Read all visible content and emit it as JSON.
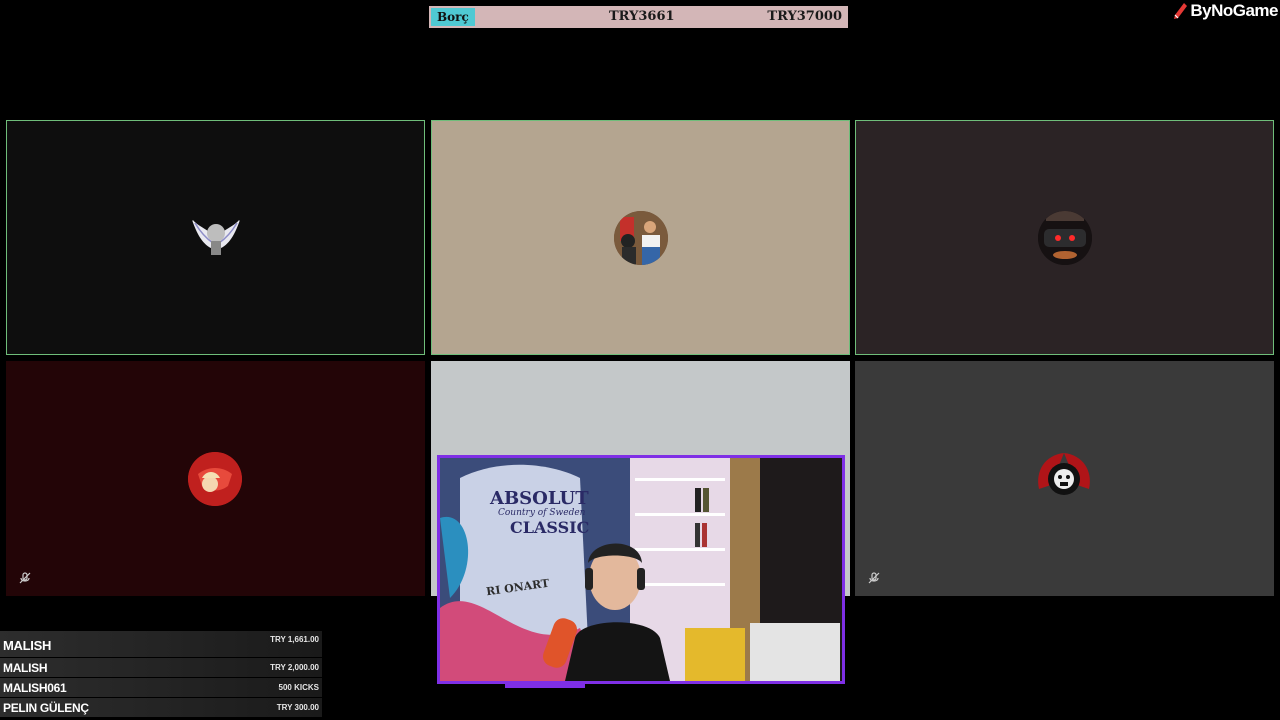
{
  "debt_bar": {
    "label": "Borç",
    "current": "TRY3661",
    "goal": "TRY37000"
  },
  "brand": {
    "name": "ByNoGame",
    "icon": "pencil-icon",
    "accent": "#e53935"
  },
  "tiles": [
    {
      "id": "tile-1",
      "avatar_icon": "winged-avatar",
      "background": "#0e0e0e",
      "active": true,
      "muted": false
    },
    {
      "id": "tile-2",
      "avatar_icon": "photo-avatar",
      "background": "#b4a590",
      "active": true,
      "muted": false
    },
    {
      "id": "tile-3",
      "avatar_icon": "car-avatar",
      "background": "#2b2325",
      "active": true,
      "muted": false
    },
    {
      "id": "tile-4",
      "avatar_icon": "red-figure-avatar",
      "background": "#230507",
      "active": false,
      "muted": true
    },
    {
      "id": "tile-5",
      "avatar_icon": "none",
      "background": "#c4c8c9",
      "active": false,
      "muted": false
    },
    {
      "id": "tile-6",
      "avatar_icon": "skull-wings-avatar",
      "background": "#3a3a3a",
      "active": false,
      "muted": true
    }
  ],
  "webcam": {
    "border_color": "#7f2fe6",
    "poster_line1": "ABSOLUT",
    "poster_line2": "Country of Sweden",
    "poster_line3": "CLASSIC",
    "poster_line4": "RI ONART"
  },
  "donations": [
    {
      "name": "MALISH",
      "amount": "TRY 1,661.00"
    },
    {
      "name": "MALISH",
      "amount": "TRY 2,000.00"
    },
    {
      "name": "MALISH061",
      "amount": "500 KICKS"
    },
    {
      "name": "PELIN GÜLENÇ",
      "amount": "TRY 300.00"
    }
  ]
}
